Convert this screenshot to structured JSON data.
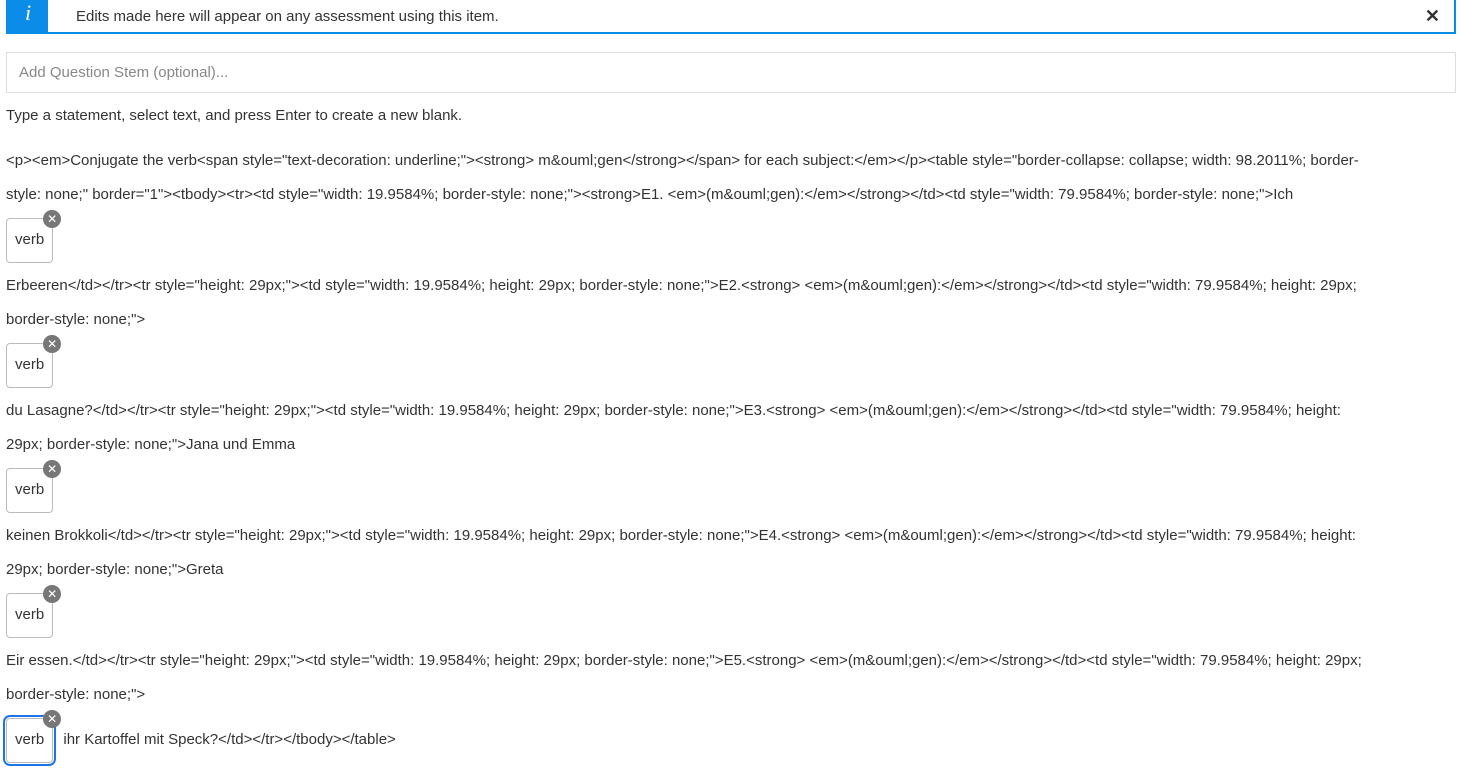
{
  "info_banner": {
    "text": "Edits made here will appear on any assessment using this item.",
    "close_glyph": "✕"
  },
  "stem": {
    "placeholder": "Add Question Stem (optional)..."
  },
  "instruction": "Type a statement, select text, and press Enter to create a new blank.",
  "blank_chip_label": "verb",
  "chip_remove_glyph": "✕",
  "lines": {
    "l0": "<p><em>Conjugate the verb<span style=\"text-decoration: underline;\"><strong> m&ouml;gen</strong></span> for each subject:</em></p><table style=\"border-collapse: collapse; width: 98.2011%; border-",
    "l1": "style: none;\" border=\"1\"><tbody><tr><td style=\"width: 19.9584%; border-style: none;\"><strong>E1. <em>(m&ouml;gen):</em></strong></td><td style=\"width: 79.9584%; border-style: none;\">Ich",
    "l2": " Erbeeren</td></tr><tr style=\"height: 29px;\"><td style=\"width: 19.9584%; height: 29px; border-style: none;\">E2.<strong> <em>(m&ouml;gen):</em></strong></td><td style=\"width: 79.9584%; height: 29px;",
    "l3": "border-style: none;\">",
    "l4": " du Lasagne?</td></tr><tr style=\"height: 29px;\"><td style=\"width: 19.9584%; height: 29px; border-style: none;\">E3.<strong> <em>(m&ouml;gen):</em></strong></td><td style=\"width: 79.9584%; height:",
    "l5": "29px; border-style: none;\">Jana und Emma",
    "l6": " keinen Brokkoli</td></tr><tr style=\"height: 29px;\"><td style=\"width: 19.9584%; height: 29px; border-style: none;\">E4.<strong> <em>(m&ouml;gen):</em></strong></td><td style=\"width: 79.9584%; height:",
    "l7": "29px; border-style: none;\">Greta",
    "l8": " Eir essen.</td></tr><tr style=\"height: 29px;\"><td style=\"width: 19.9584%; height: 29px; border-style: none;\">E5.<strong> <em>(m&ouml;gen):</em></strong></td><td style=\"width: 79.9584%; height: 29px;",
    "l9": "border-style: none;\">",
    "l10_after_chip": " ihr Kartoffel mit Speck?</td></tr></tbody></table>"
  }
}
